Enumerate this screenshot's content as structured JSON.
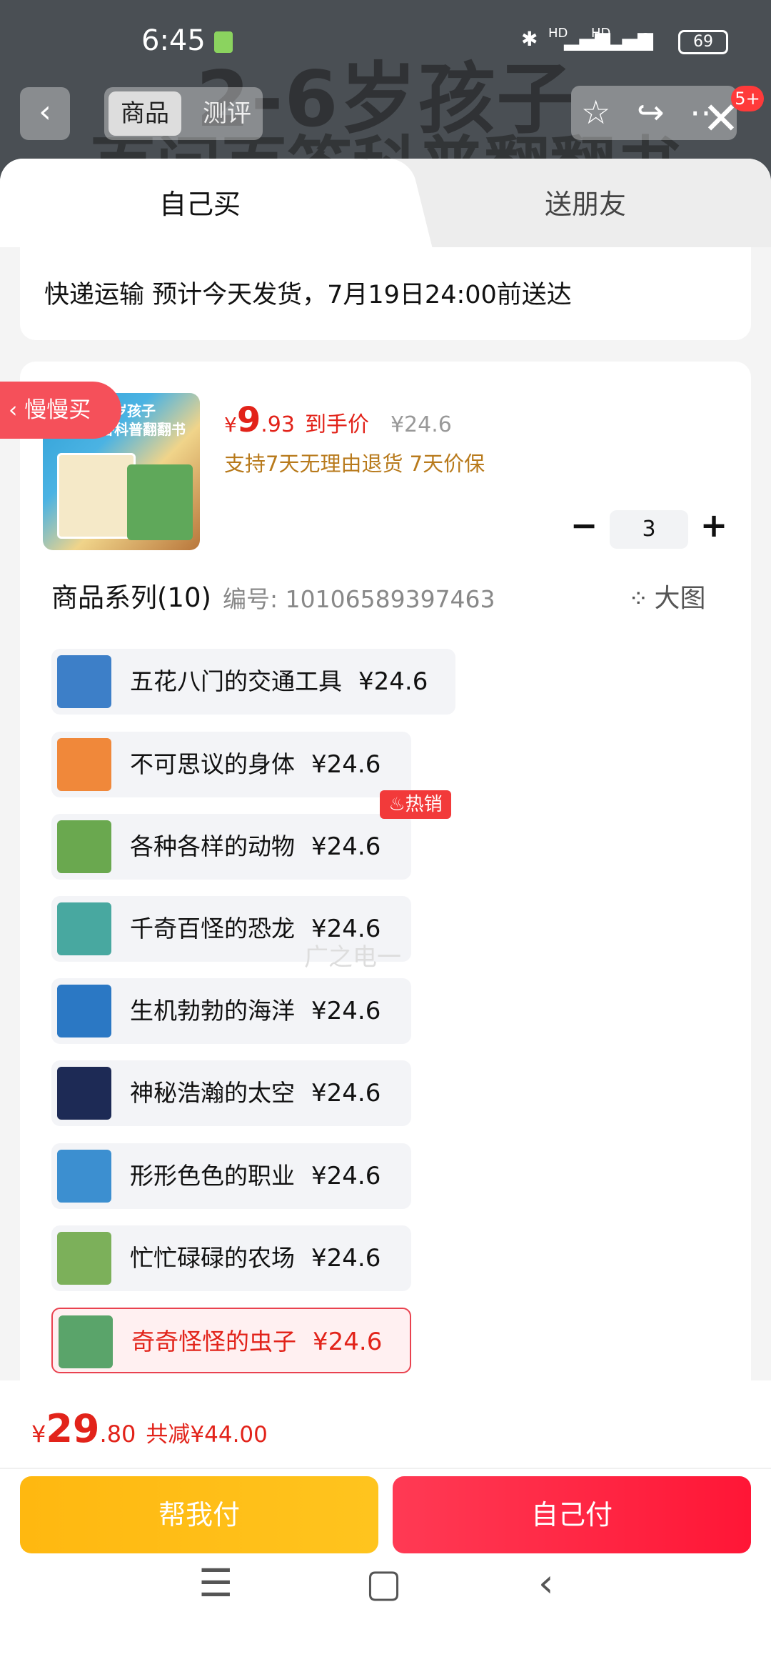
{
  "status_bar": {
    "time": "6:45",
    "signal1": "HD",
    "signal2": "HD",
    "battery": "69"
  },
  "background": {
    "title_line1": "2-6岁孩子",
    "title_line2": "百问百答科普翻翻书"
  },
  "top_nav": {
    "back_icon": "chevron-left-icon",
    "tab_goods": "商品",
    "tab_review": "测评",
    "badge": "5+",
    "icons": [
      "star-icon",
      "share-icon",
      "more-icon",
      "close-icon"
    ]
  },
  "sheet": {
    "tab_self": "自己买",
    "tab_gift": "送朋友",
    "shipping": "快递运输 预计今天发货，7月19日24:00前送达"
  },
  "product": {
    "cover_title": "2-6岁孩子\n百问百答科普翻翻书",
    "price_currency": "¥",
    "price_int": "9",
    "price_dec": ".93",
    "price_label": "到手价",
    "original_price": "¥24.6",
    "tags": "支持7天无理由退货  7天价保",
    "quantity_minus": "−",
    "quantity": "3",
    "quantity_plus": "+"
  },
  "series": {
    "title": "商品系列(10)",
    "code": "编号: 10106589397463",
    "big_picture": "大图",
    "hot_badge": "热销",
    "items": [
      {
        "name": "五花八门的交通工具",
        "price": "¥24.6",
        "thumb_color": "#3d7fc8"
      },
      {
        "name": "不可思议的身体",
        "price": "¥24.6",
        "thumb_color": "#f0883a"
      },
      {
        "name": "各种各样的动物",
        "price": "¥24.6",
        "thumb_color": "#6aa84f"
      },
      {
        "name": "千奇百怪的恐龙",
        "price": "¥24.6",
        "thumb_color": "#48a8a0"
      },
      {
        "name": "生机勃勃的海洋",
        "price": "¥24.6",
        "thumb_color": "#2b78c4"
      },
      {
        "name": "神秘浩瀚的太空",
        "price": "¥24.6",
        "thumb_color": "#1d2a55"
      },
      {
        "name": "形形色色的职业",
        "price": "¥24.6",
        "thumb_color": "#3c8fd0"
      },
      {
        "name": "忙忙碌碌的农场",
        "price": "¥24.6",
        "thumb_color": "#7cb05a"
      },
      {
        "name": "奇奇怪怪的虫子",
        "price": "¥24.6",
        "thumb_color": "#5aa46a"
      }
    ]
  },
  "floater": {
    "label": "慢慢买"
  },
  "watermark": "广之电一",
  "footer": {
    "total_currency": "¥",
    "total_int": "29",
    "total_dec": ".80",
    "discount": "共减¥44.00",
    "btn_help": "帮我付",
    "btn_self": "自己付"
  },
  "system_nav": [
    "menu-icon",
    "home-icon",
    "back-icon"
  ]
}
